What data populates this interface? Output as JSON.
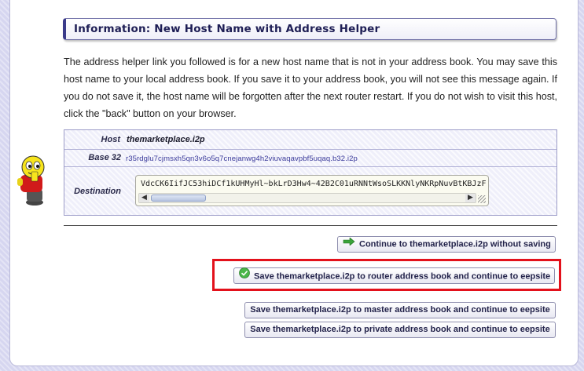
{
  "header": {
    "title": "Information: New Host Name with Address Helper"
  },
  "intro_text": "The address helper link you followed is for a new host name that is not in your address book. You may save this host name to your local address book. If you save it to your address book, you will not see this message again. If you do not save it, the host name will be forgotten after the next router restart. If you do not wish to visit this host, click the \"back\" button on your browser.",
  "details": {
    "host_label": "Host",
    "host_value": "themarketplace.i2p",
    "base32_label": "Base 32",
    "base32_value": "r35rdglu7cjmsxh5qn3v6o5q7cnejanwg4h2viuvaqavpbf5uqaq.b32.i2p",
    "destination_label": "Destination",
    "destination_value": "VdcCK6IifJC53hiDCf1kUHMyHl~bkLrD3Hw4~42B2C01uRNNtWsoSLKKNlyNKRpNuvBtKBJzF"
  },
  "buttons": {
    "continue_without_saving": "Continue to themarketplace.i2p without saving",
    "save_router": "Save themarketplace.i2p to router address book and continue to eepsite",
    "save_master": "Save themarketplace.i2p to master address book and continue to eepsite",
    "save_private": "Save themarketplace.i2p to private address book and continue to eepsite"
  },
  "icons": {
    "mascot": "i2p-mascot-icon",
    "continue": "green-arrow-icon",
    "save_router": "green-check-icon"
  },
  "colors": {
    "highlight": "#e3111b",
    "header_text": "#1e1e55",
    "link": "#3b3b9b"
  }
}
